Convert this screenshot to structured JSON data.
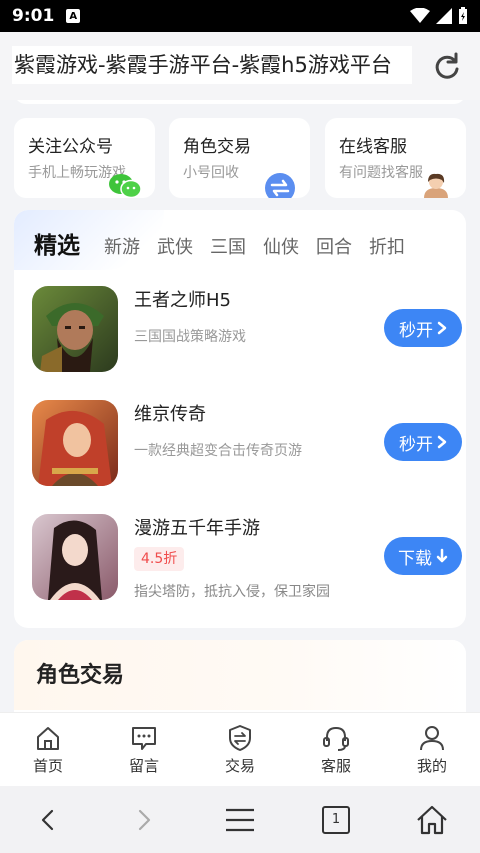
{
  "status_bar": {
    "time": "9:01",
    "notification_glyph": "A"
  },
  "browser": {
    "page_title": "紫霞游戏-紫霞手游平台-紫霞h5游戏平台"
  },
  "quick_links": [
    {
      "title": "关注公众号",
      "subtitle": "手机上畅玩游戏",
      "icon": "wechat-icon"
    },
    {
      "title": "角色交易",
      "subtitle": "小号回收",
      "icon": "exchange-icon"
    },
    {
      "title": "在线客服",
      "subtitle": "有问题找客服",
      "icon": "agent-avatar-icon"
    }
  ],
  "featured": {
    "heading": "精选",
    "tabs": [
      "新游",
      "武侠",
      "三国",
      "仙侠",
      "回合",
      "折扣"
    ],
    "games": [
      {
        "name": "王者之师H5",
        "desc": "三国国战策略游戏",
        "action": "秒开"
      },
      {
        "name": "维京传奇",
        "desc": "一款经典超变合击传奇页游",
        "action": "秒开"
      },
      {
        "name": "漫游五千年手游",
        "discount": "4.5折",
        "desc": "指尖塔防，抵抗入侵，保卫家园",
        "action": "下载"
      }
    ]
  },
  "trade_section": {
    "title": "角色交易"
  },
  "tab_bar": [
    {
      "label": "首页",
      "icon": "home-icon"
    },
    {
      "label": "留言",
      "icon": "message-icon"
    },
    {
      "label": "交易",
      "icon": "trade-shield-icon"
    },
    {
      "label": "客服",
      "icon": "headset-icon"
    },
    {
      "label": "我的",
      "icon": "user-icon"
    }
  ],
  "nav_bar": {
    "tab_count": "1"
  },
  "colors": {
    "accent": "#3d86f5",
    "discount": "#f04c4c"
  }
}
